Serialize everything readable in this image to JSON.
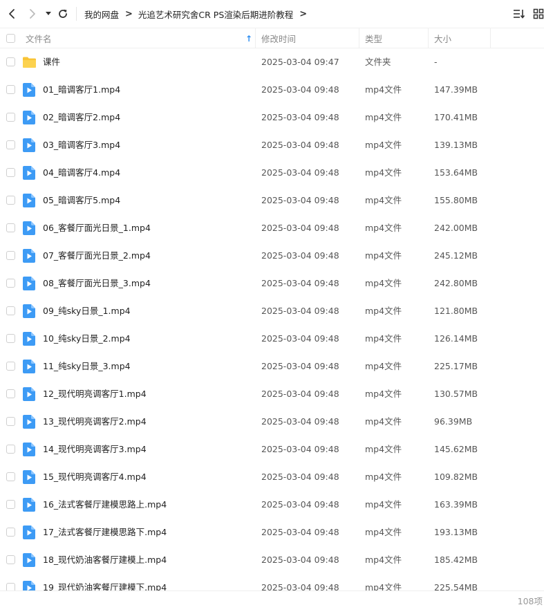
{
  "toolbar": {
    "back_icon": "chevron-left-icon",
    "forward_icon": "chevron-right-icon",
    "history_icon": "caret-down-icon",
    "refresh_icon": "refresh-icon",
    "sort_icon": "sort-icon",
    "view_icon": "grid-view-icon"
  },
  "breadcrumb": [
    "我的网盘",
    "光追艺术研究舍CR PS渲染后期进阶教程"
  ],
  "columns": {
    "name": "文件名",
    "modified": "修改时间",
    "type": "类型",
    "size": "大小",
    "sort_arrow": "↑"
  },
  "files": [
    {
      "name": "课件",
      "modified": "2025-03-04 09:47",
      "type": "文件夹",
      "size": "-",
      "icon": "folder-icon"
    },
    {
      "name": "01_暗调客厅1.mp4",
      "modified": "2025-03-04 09:48",
      "type": "mp4文件",
      "size": "147.39MB",
      "icon": "video-file-icon"
    },
    {
      "name": "02_暗调客厅2.mp4",
      "modified": "2025-03-04 09:48",
      "type": "mp4文件",
      "size": "170.41MB",
      "icon": "video-file-icon"
    },
    {
      "name": "03_暗调客厅3.mp4",
      "modified": "2025-03-04 09:48",
      "type": "mp4文件",
      "size": "139.13MB",
      "icon": "video-file-icon"
    },
    {
      "name": "04_暗调客厅4.mp4",
      "modified": "2025-03-04 09:48",
      "type": "mp4文件",
      "size": "153.64MB",
      "icon": "video-file-icon"
    },
    {
      "name": "05_暗调客厅5.mp4",
      "modified": "2025-03-04 09:48",
      "type": "mp4文件",
      "size": "155.80MB",
      "icon": "video-file-icon"
    },
    {
      "name": "06_客餐厅面光日景_1.mp4",
      "modified": "2025-03-04 09:48",
      "type": "mp4文件",
      "size": "242.00MB",
      "icon": "video-file-icon"
    },
    {
      "name": "07_客餐厅面光日景_2.mp4",
      "modified": "2025-03-04 09:48",
      "type": "mp4文件",
      "size": "245.12MB",
      "icon": "video-file-icon"
    },
    {
      "name": "08_客餐厅面光日景_3.mp4",
      "modified": "2025-03-04 09:48",
      "type": "mp4文件",
      "size": "242.80MB",
      "icon": "video-file-icon"
    },
    {
      "name": "09_纯sky日景_1.mp4",
      "modified": "2025-03-04 09:48",
      "type": "mp4文件",
      "size": "121.80MB",
      "icon": "video-file-icon"
    },
    {
      "name": "10_纯sky日景_2.mp4",
      "modified": "2025-03-04 09:48",
      "type": "mp4文件",
      "size": "126.14MB",
      "icon": "video-file-icon"
    },
    {
      "name": "11_纯sky日景_3.mp4",
      "modified": "2025-03-04 09:48",
      "type": "mp4文件",
      "size": "225.17MB",
      "icon": "video-file-icon"
    },
    {
      "name": "12_现代明亮调客厅1.mp4",
      "modified": "2025-03-04 09:48",
      "type": "mp4文件",
      "size": "130.57MB",
      "icon": "video-file-icon"
    },
    {
      "name": "13_现代明亮调客厅2.mp4",
      "modified": "2025-03-04 09:48",
      "type": "mp4文件",
      "size": "96.39MB",
      "icon": "video-file-icon"
    },
    {
      "name": "14_现代明亮调客厅3.mp4",
      "modified": "2025-03-04 09:48",
      "type": "mp4文件",
      "size": "145.62MB",
      "icon": "video-file-icon"
    },
    {
      "name": "15_现代明亮调客厅4.mp4",
      "modified": "2025-03-04 09:48",
      "type": "mp4文件",
      "size": "109.82MB",
      "icon": "video-file-icon"
    },
    {
      "name": "16_法式客餐厅建模思路上.mp4",
      "modified": "2025-03-04 09:48",
      "type": "mp4文件",
      "size": "163.39MB",
      "icon": "video-file-icon"
    },
    {
      "name": "17_法式客餐厅建模思路下.mp4",
      "modified": "2025-03-04 09:48",
      "type": "mp4文件",
      "size": "193.13MB",
      "icon": "video-file-icon"
    },
    {
      "name": "18_现代奶油客餐厅建模上.mp4",
      "modified": "2025-03-04 09:48",
      "type": "mp4文件",
      "size": "185.42MB",
      "icon": "video-file-icon"
    },
    {
      "name": "19_现代奶油客餐厅建模下.mp4",
      "modified": "2025-03-04 09:48",
      "type": "mp4文件",
      "size": "225.54MB",
      "icon": "video-file-icon"
    }
  ],
  "footer": {
    "item_count": "108项"
  },
  "colors": {
    "accent": "#2b8cf0",
    "folder": "#f9c436",
    "video_icon": "#3d9bf5"
  }
}
